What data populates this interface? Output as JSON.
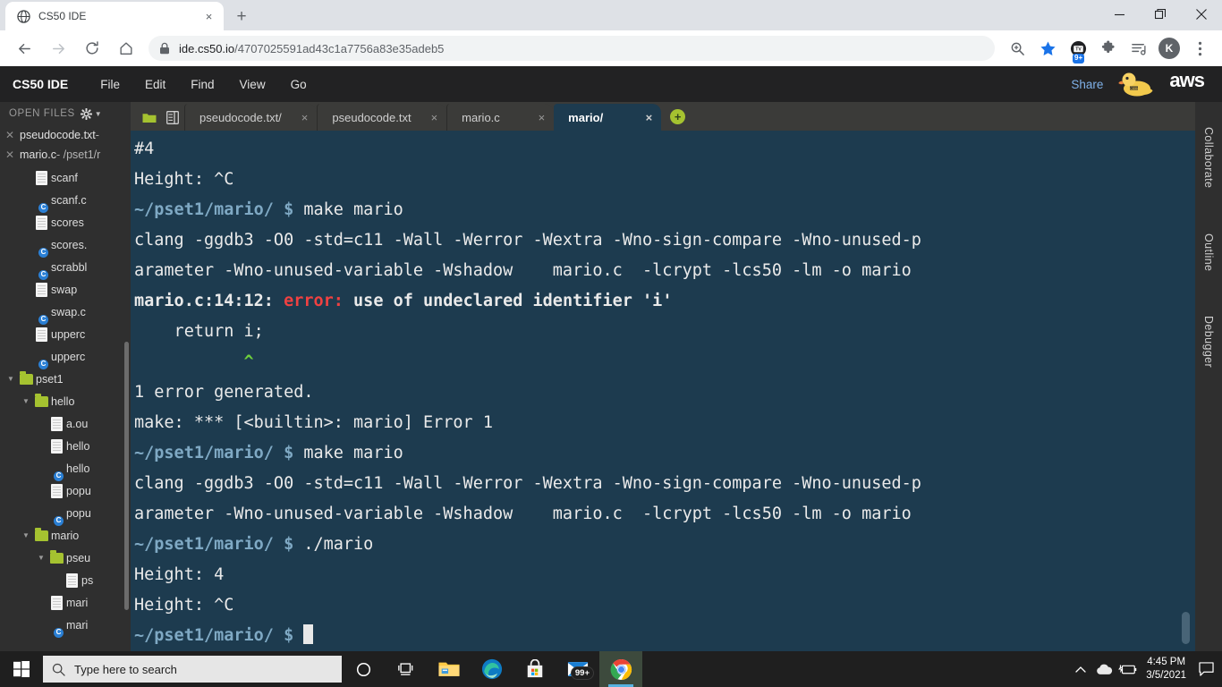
{
  "browser": {
    "tab": {
      "title": "CS50 IDE",
      "favicon": "globe-icon",
      "close_label": "×"
    },
    "new_tab_label": "+",
    "window_controls": {
      "minimize": "—",
      "restore": "❐",
      "close": "✕"
    },
    "toolbar": {
      "back": "←",
      "forward": "→",
      "reload": "⟳",
      "home": "⌂",
      "url_host": "ide.cs50.io",
      "url_path": "/4707025591ad43c1a7756a83e35adeb5",
      "lock_icon": "lock-icon",
      "zoom_icon": "zoom-magnifier-icon",
      "bookmark_icon": "star-icon",
      "extension_badge": "9+",
      "puzzle_icon": "extensions-puzzle-icon",
      "readinglist_icon": "reading-list-icon",
      "profile_initial": "K",
      "menu_icon": "three-dot-menu-icon"
    }
  },
  "ide": {
    "brand": "CS50 IDE",
    "menu": [
      "File",
      "Edit",
      "Find",
      "View",
      "Go"
    ],
    "share_label": "Share",
    "duck_icon": "cs50-duck-icon",
    "aws_logo": "aws",
    "sidebar": {
      "open_files_label": "OPEN FILES",
      "gear_icon": "gear-icon",
      "caret_icon": "chevron-down-icon",
      "open_files": [
        {
          "name": "pseudocode.txt",
          "path": " - "
        },
        {
          "name": "mario.c",
          "path": " - /pset1/r"
        }
      ],
      "tree": [
        {
          "depth": 2,
          "type": "file",
          "label": "scanf",
          "twisty": ""
        },
        {
          "depth": 2,
          "type": "cfile",
          "label": "scanf.c",
          "twisty": ""
        },
        {
          "depth": 2,
          "type": "file",
          "label": "scores",
          "twisty": ""
        },
        {
          "depth": 2,
          "type": "cfile",
          "label": "scores.",
          "twisty": ""
        },
        {
          "depth": 2,
          "type": "cfile",
          "label": "scrabbl",
          "twisty": ""
        },
        {
          "depth": 2,
          "type": "file",
          "label": "swap",
          "twisty": ""
        },
        {
          "depth": 2,
          "type": "cfile",
          "label": "swap.c",
          "twisty": ""
        },
        {
          "depth": 2,
          "type": "file",
          "label": "upperc",
          "twisty": ""
        },
        {
          "depth": 2,
          "type": "cfile",
          "label": "upperc",
          "twisty": ""
        },
        {
          "depth": 1,
          "type": "folder",
          "label": "pset1",
          "twisty": "▼"
        },
        {
          "depth": 2,
          "type": "folder",
          "label": "hello",
          "twisty": "▼"
        },
        {
          "depth": 3,
          "type": "file",
          "label": "a.ou",
          "twisty": ""
        },
        {
          "depth": 3,
          "type": "file",
          "label": "hello",
          "twisty": ""
        },
        {
          "depth": 3,
          "type": "cfile",
          "label": "hello",
          "twisty": ""
        },
        {
          "depth": 3,
          "type": "file",
          "label": "popu",
          "twisty": ""
        },
        {
          "depth": 3,
          "type": "cfile",
          "label": "popu",
          "twisty": ""
        },
        {
          "depth": 2,
          "type": "folder",
          "label": "mario",
          "twisty": "▼"
        },
        {
          "depth": 3,
          "type": "folder",
          "label": "pseu",
          "twisty": "▼"
        },
        {
          "depth": 4,
          "type": "file",
          "label": "ps",
          "twisty": ""
        },
        {
          "depth": 3,
          "type": "file",
          "label": "mari",
          "twisty": ""
        },
        {
          "depth": 3,
          "type": "cfile",
          "label": "mari",
          "twisty": ""
        }
      ]
    },
    "editor_tabs": [
      {
        "label": "pseudocode.txt/",
        "active": false,
        "close": "×"
      },
      {
        "label": "pseudocode.txt",
        "active": false,
        "close": "×"
      },
      {
        "label": "mario.c",
        "active": false,
        "close": "×"
      },
      {
        "label": "mario/",
        "active": true,
        "close": "×"
      }
    ],
    "add_tab_label": "+",
    "folder_button_icon": "folder-icon",
    "split_button_icon": "panel-layout-icon",
    "right_rail_tabs": [
      "Collaborate",
      "Outline",
      "Debugger"
    ],
    "terminal": {
      "prompt": "~/pset1/mario/ $ ",
      "lines": [
        {
          "kind": "plain",
          "text": "#4"
        },
        {
          "kind": "plain",
          "text": "Height: ^C"
        },
        {
          "kind": "prompt",
          "cmd": "make mario"
        },
        {
          "kind": "plain",
          "text": "clang -ggdb3 -O0 -std=c11 -Wall -Werror -Wextra -Wno-sign-compare -Wno-unused-p"
        },
        {
          "kind": "plain",
          "text": "arameter -Wno-unused-variable -Wshadow    mario.c  -lcrypt -lcs50 -lm -o mario"
        },
        {
          "kind": "error",
          "loc": "mario.c:14:12: ",
          "err": "error: ",
          "msg": "use of undeclared identifier 'i'"
        },
        {
          "kind": "plain",
          "text": "    return i;"
        },
        {
          "kind": "caret",
          "text": "           ^"
        },
        {
          "kind": "plain",
          "text": "1 error generated."
        },
        {
          "kind": "plain",
          "text": "make: *** [<builtin>: mario] Error 1"
        },
        {
          "kind": "prompt",
          "cmd": "make mario"
        },
        {
          "kind": "plain",
          "text": "clang -ggdb3 -O0 -std=c11 -Wall -Werror -Wextra -Wno-sign-compare -Wno-unused-p"
        },
        {
          "kind": "plain",
          "text": "arameter -Wno-unused-variable -Wshadow    mario.c  -lcrypt -lcs50 -lm -o mario"
        },
        {
          "kind": "prompt",
          "cmd": "./mario"
        },
        {
          "kind": "plain",
          "text": "Height: 4"
        },
        {
          "kind": "plain",
          "text": "Height: ^C"
        },
        {
          "kind": "cursor",
          "cmd": ""
        }
      ]
    }
  },
  "taskbar": {
    "start_icon": "windows-start-icon",
    "search_placeholder": "Type here to search",
    "search_icon": "search-icon",
    "cortana_icon": "cortana-circle-icon",
    "taskview_icon": "task-view-icon",
    "apps": [
      {
        "name": "file-explorer",
        "active": false,
        "badge": ""
      },
      {
        "name": "microsoft-edge",
        "active": false,
        "badge": ""
      },
      {
        "name": "microsoft-store",
        "active": false,
        "badge": ""
      },
      {
        "name": "mail",
        "active": false,
        "badge": "99+"
      },
      {
        "name": "google-chrome",
        "active": true,
        "badge": ""
      }
    ],
    "tray": {
      "chevron": "⌃",
      "onedrive_icon": "onedrive-cloud-icon",
      "battery_icon": "battery-charging-icon",
      "time": "4:45 PM",
      "date": "3/5/2021",
      "action_center_icon": "action-center-icon"
    }
  },
  "colors": {
    "terminal_bg": "#1d3b4f",
    "error_red": "#f04141",
    "prompt_blue": "#7fa9c4",
    "caret_green": "#6fd13c",
    "folder_green": "#a5c230",
    "accent_blue": "#1a73e8"
  }
}
